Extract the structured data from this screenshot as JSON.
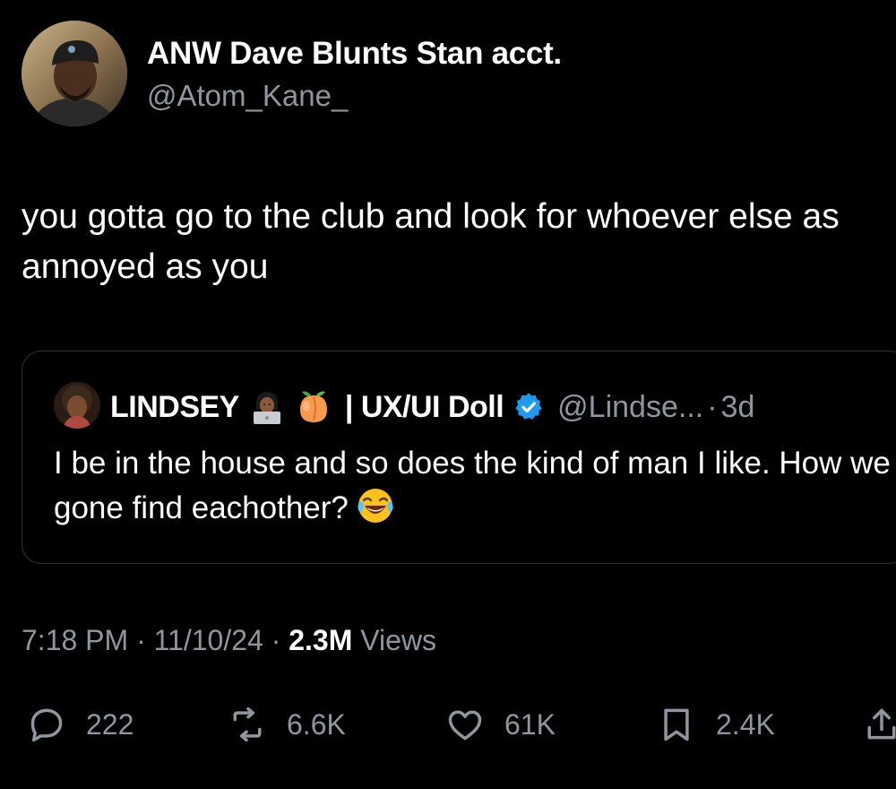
{
  "author": {
    "display_name": "ANW Dave Blunts Stan acct.",
    "handle": "@Atom_Kane_"
  },
  "tweet": {
    "text": "you gotta go to the club and look for whoever else as annoyed as you"
  },
  "quoted_tweet": {
    "name": "LINDSEY",
    "name_suffix": "| UX/UI Doll",
    "handle": "@Lindse...",
    "separator": "·",
    "age": "3d",
    "verified": true,
    "text": "I be in the house and so does the kind of man I like. How we gone find eachother?",
    "emojis": [
      "woman-technologist-emoji",
      "peach-emoji",
      "laughing-tears-emoji"
    ]
  },
  "meta": {
    "time": "7:18 PM",
    "sep1": " · ",
    "date": "11/10/24",
    "sep2": " · ",
    "views_count": "2.3M",
    "views_label": " Views"
  },
  "actions": {
    "replies": "222",
    "reposts": "6.6K",
    "likes": "61K",
    "bookmarks": "2.4K"
  },
  "colors": {
    "background": "#000000",
    "text": "#ffffff",
    "secondary_text": "#8f969d",
    "border": "#2f3336",
    "verified": "#1d9bf0"
  },
  "icons": [
    "reply-icon",
    "repost-icon",
    "like-icon",
    "bookmark-icon",
    "share-icon",
    "verified-badge-icon"
  ]
}
